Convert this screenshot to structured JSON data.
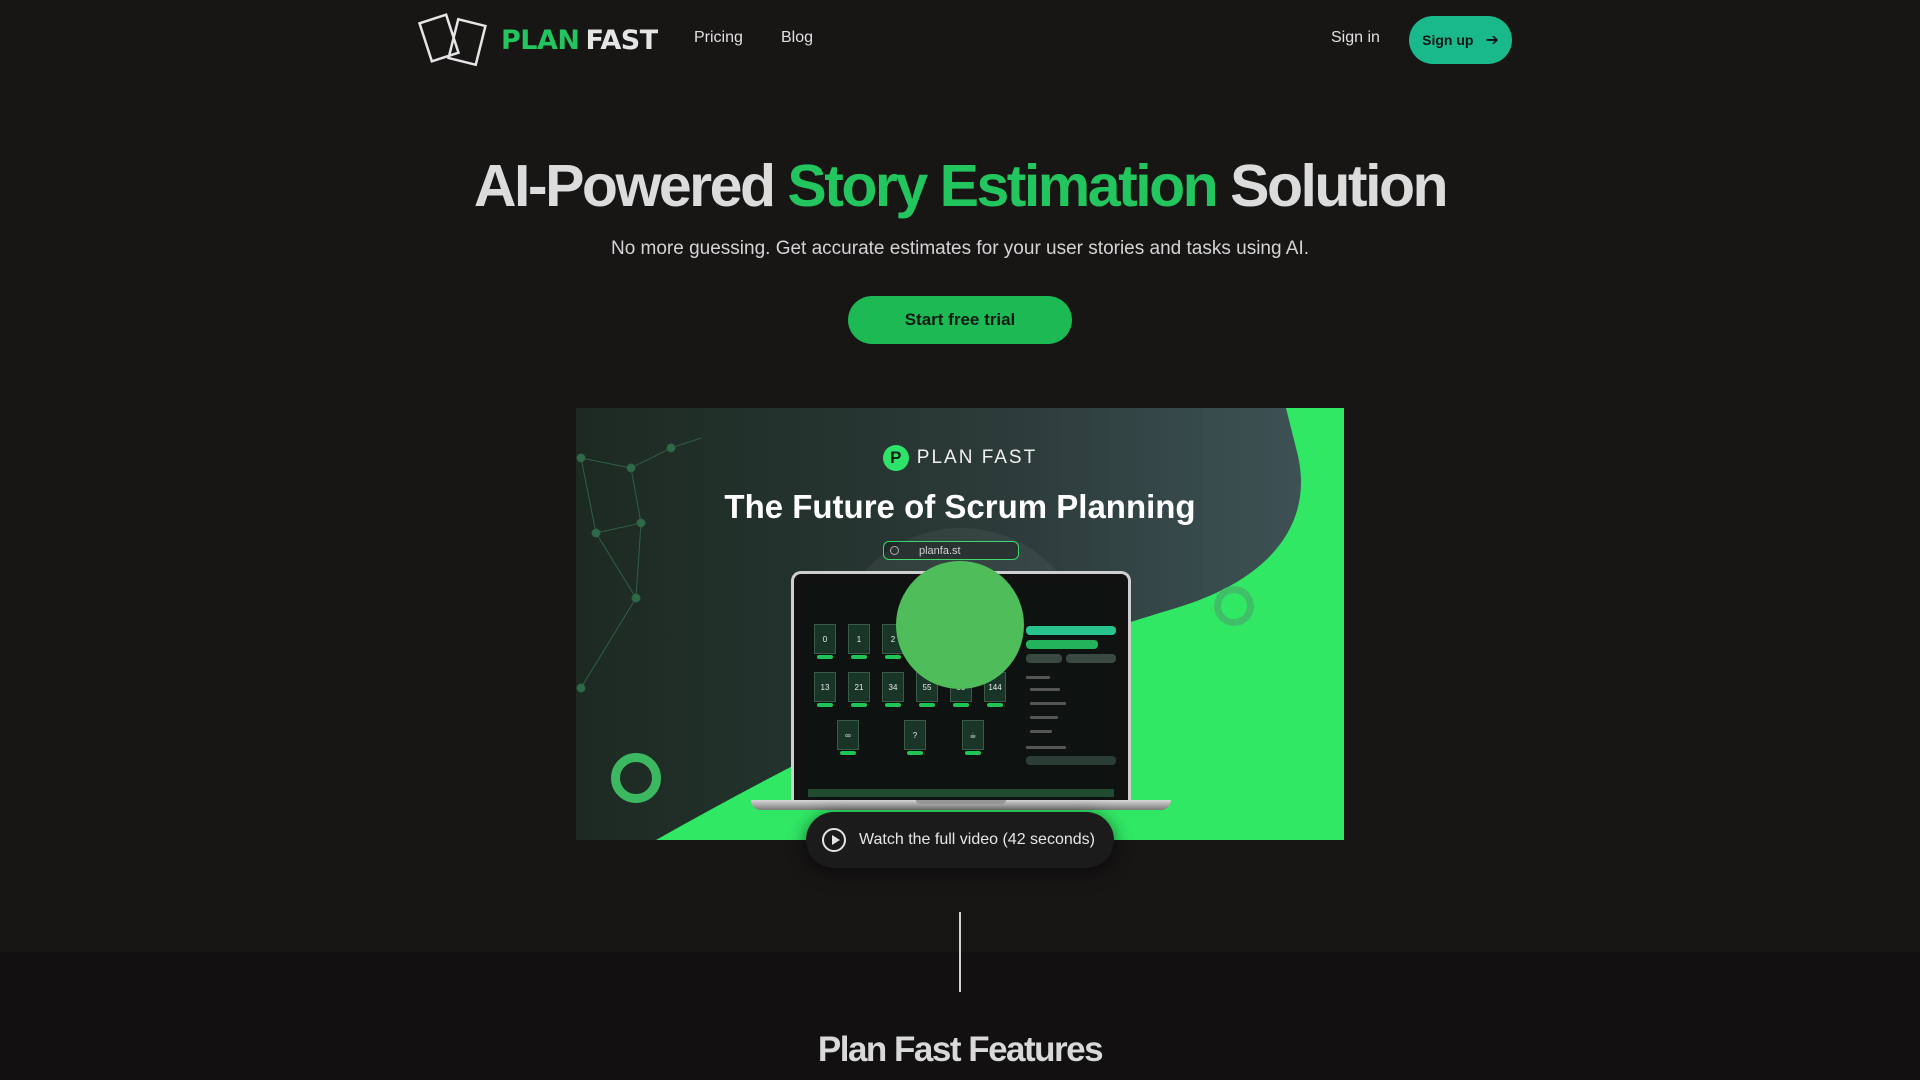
{
  "nav": {
    "logo_plan": "PLAN",
    "logo_fast": "FAST",
    "pricing": "Pricing",
    "blog": "Blog",
    "sign_in": "Sign in",
    "sign_up": "Sign up",
    "sign_up_icon": "arrow-right-icon"
  },
  "hero": {
    "title_part1": "AI-Powered",
    "title_accent": "Story Estimation",
    "title_part2": "Solution",
    "subtitle": "No more guessing. Get accurate estimates for your user stories and tasks using AI.",
    "cta": "Start free trial"
  },
  "video": {
    "brand_letter": "P",
    "brand_name": "PLAN FAST",
    "headline": "The Future of Scrum Planning",
    "search_text": "planfa.st",
    "cards": [
      "0",
      "1",
      "2",
      "13",
      "21",
      "34",
      "55",
      "89",
      "144",
      "∞",
      "?",
      "☕"
    ],
    "watch_label": "Watch the full video (42 seconds)"
  },
  "features": {
    "title": "Plan Fast Features"
  },
  "colors": {
    "background": "#181515",
    "accent_green": "#22c55e",
    "signup_teal": "#1ab98b",
    "cta_green": "#1db954",
    "video_bright_green": "#31e865"
  }
}
